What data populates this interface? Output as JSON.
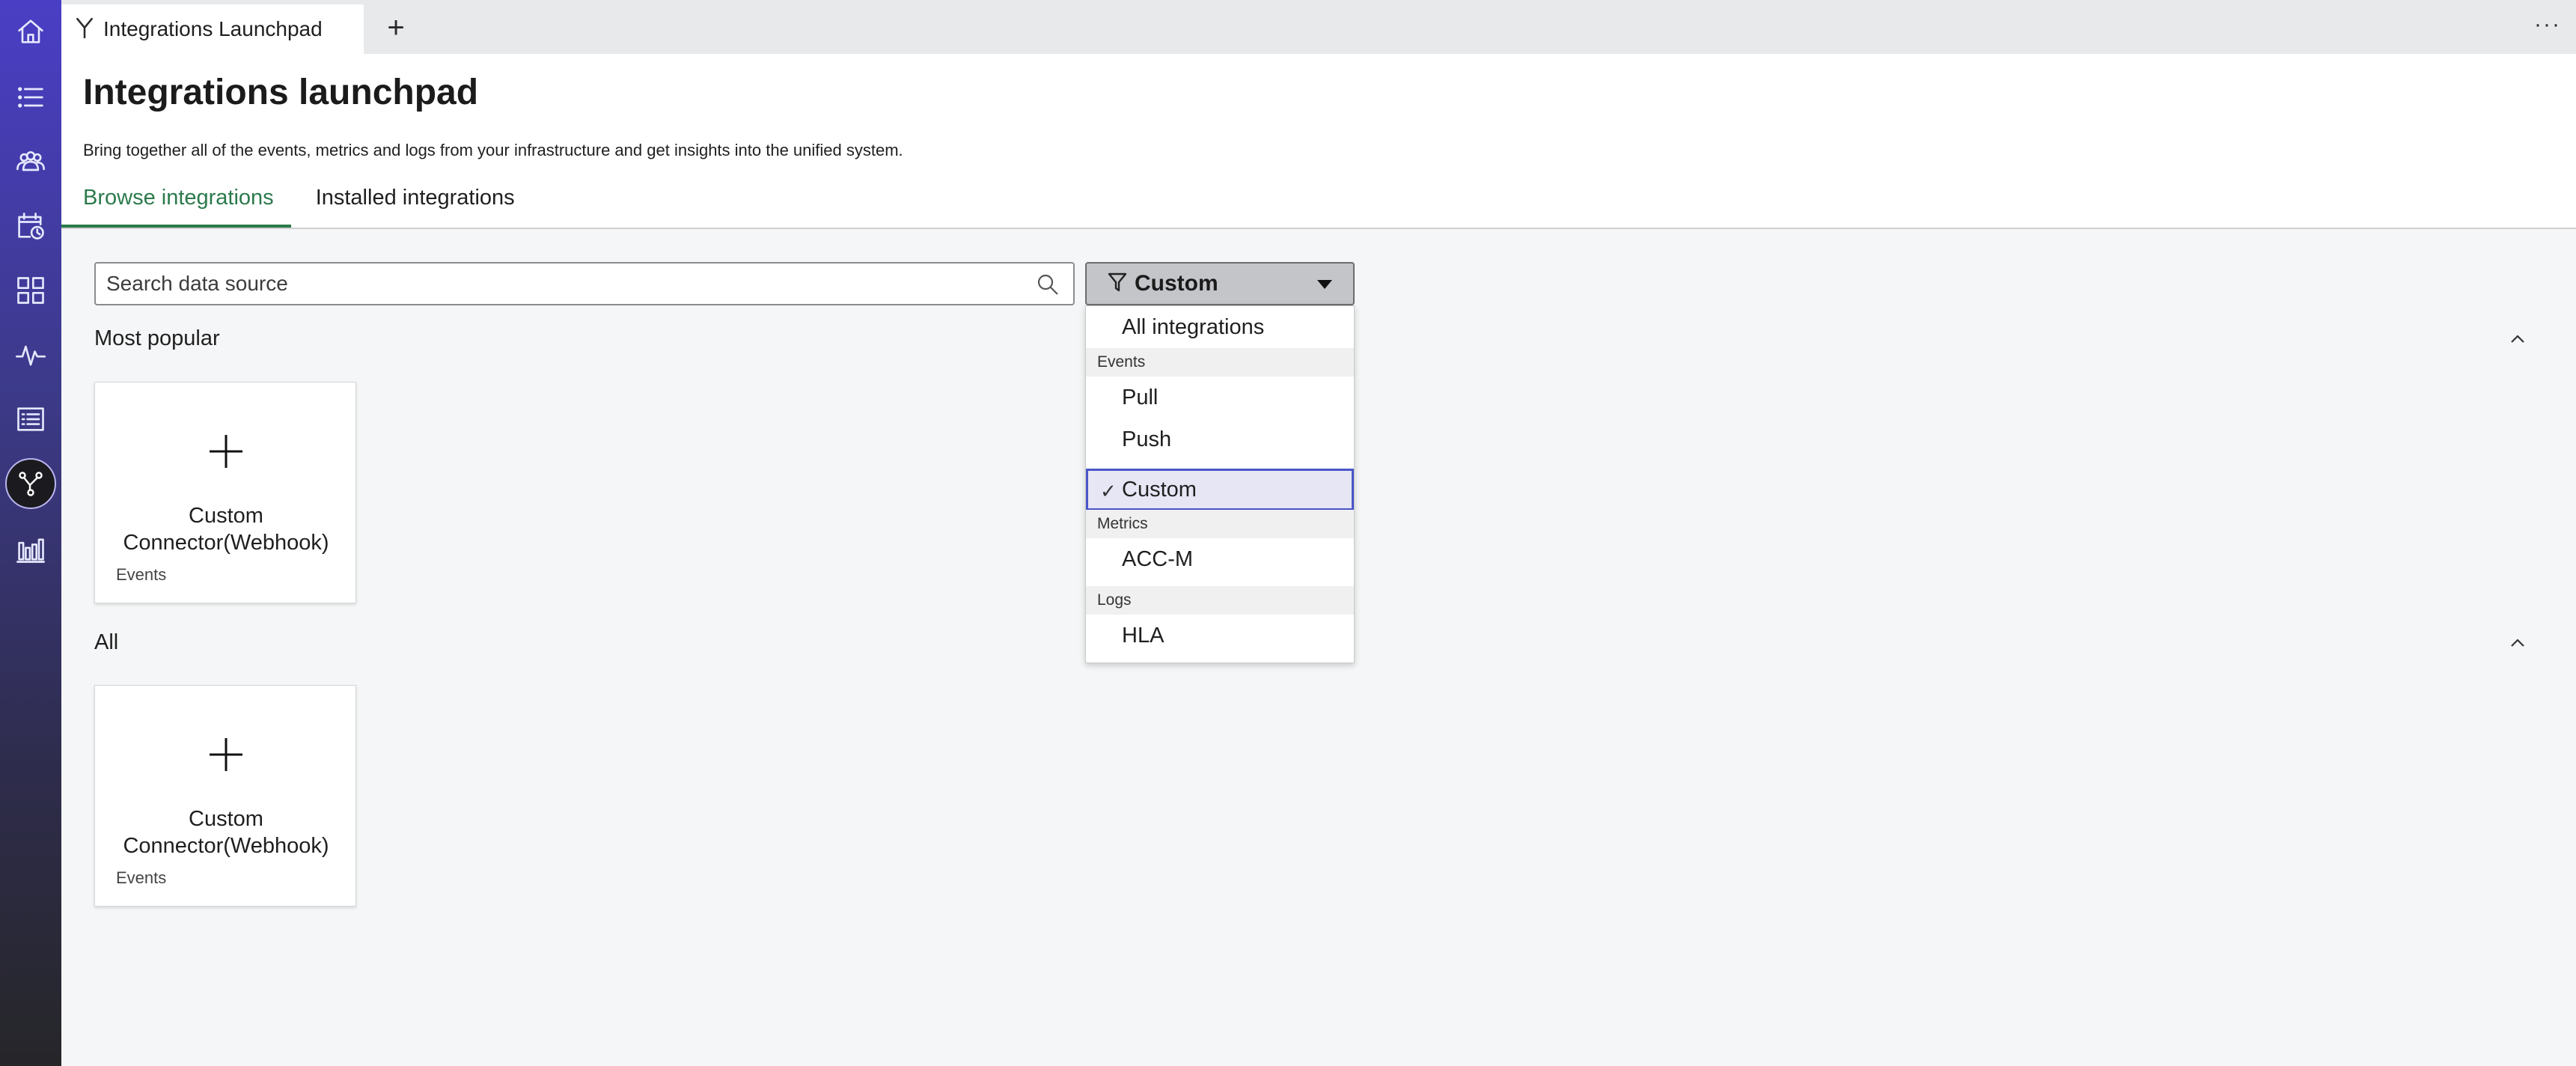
{
  "tabbar": {
    "tab_label": "Integrations Launchpad",
    "add_label": "+",
    "more_label": "···"
  },
  "page": {
    "title": "Integrations launchpad",
    "description": "Bring together all of the events, metrics and logs from your infrastructure and get insights into the unified system."
  },
  "tabs": [
    "Browse integrations",
    "Installed integrations"
  ],
  "search": {
    "placeholder": "Search data source"
  },
  "filter": {
    "selected": "Custom",
    "options": {
      "all": "All integrations",
      "group_events": "Events",
      "pull": "Pull",
      "push": "Push",
      "custom": "Custom",
      "group_metrics": "Metrics",
      "accm": "ACC-M",
      "group_logs": "Logs",
      "hla": "HLA"
    }
  },
  "sections": [
    {
      "title": "Most popular",
      "card": {
        "title_line1": "Custom",
        "title_line2": "Connector(Webhook)",
        "subtitle": "Events"
      }
    },
    {
      "title": "All",
      "card": {
        "title_line1": "Custom",
        "title_line2": "Connector(Webhook)",
        "subtitle": "Events"
      }
    }
  ],
  "colors": {
    "accent_green": "#2b7a4b",
    "selected_border": "#4a55c9",
    "sidebar_top": "#4a3ec5"
  }
}
